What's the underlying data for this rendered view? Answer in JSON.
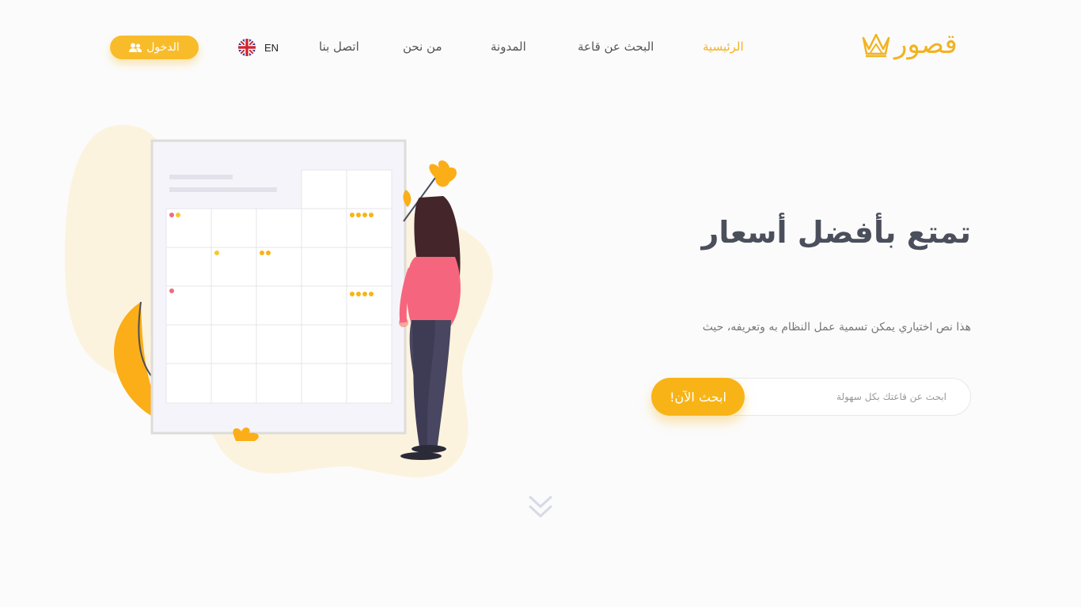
{
  "header": {
    "logo_text": "قصور",
    "nav": [
      {
        "label": "الرئيسية",
        "active": true
      },
      {
        "label": "البحث عن قاعة",
        "active": false
      },
      {
        "label": "المدونة",
        "active": false
      },
      {
        "label": "من نحن",
        "active": false
      },
      {
        "label": "اتصل بنا",
        "active": false
      }
    ],
    "language": "EN",
    "login_label": "الدخول"
  },
  "hero": {
    "title": "تمتع بأفضل أسعار",
    "subtitle": "هذا نص اختياري يمكن تسمية عمل النظام به وتعريفه، حيث",
    "search_placeholder": "ابحث عن قاعتك بكل سهولة",
    "search_button": "ابحث الآن!"
  },
  "colors": {
    "accent": "#f8bc2b",
    "title": "#4b4f5c",
    "blob": "#fcf3df"
  },
  "icons": {
    "logo": "crown-icon",
    "language": "uk-flag-icon",
    "login": "users-icon",
    "scroll": "double-chevron-down-icon"
  }
}
